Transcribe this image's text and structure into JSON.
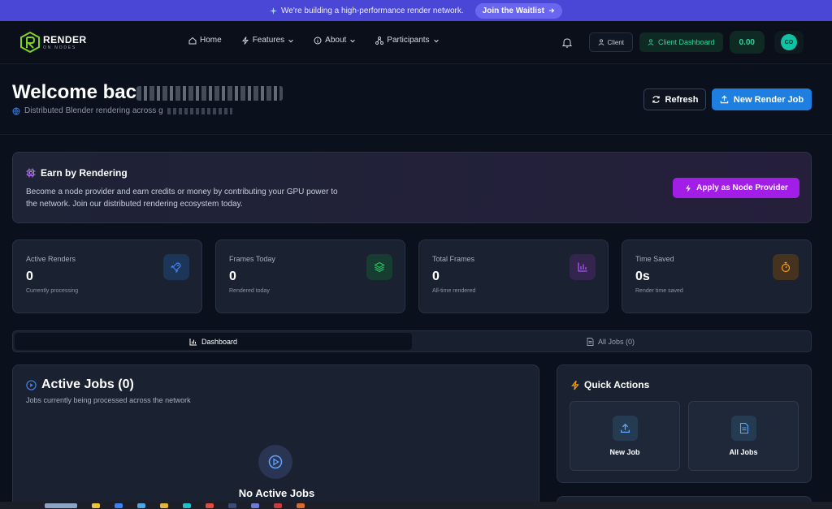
{
  "banner": {
    "message": "We're building a high-performance render network.",
    "cta": "Join the Waitlist"
  },
  "brand": {
    "name": "RENDER",
    "tagline": "ON NODES"
  },
  "nav": {
    "items": [
      {
        "label": "Home"
      },
      {
        "label": "Features"
      },
      {
        "label": "About"
      },
      {
        "label": "Participants"
      }
    ],
    "client_label": "Client",
    "dashboard_label": "Client Dashboard",
    "balance": "0.00",
    "avatar_initials": "CO"
  },
  "hero": {
    "welcome": "Welcome bac",
    "subtitle": "Distributed Blender rendering across g",
    "refresh_label": "Refresh",
    "new_job_label": "New Render Job"
  },
  "earn": {
    "title": "Earn by Rendering",
    "description": "Become a node provider and earn credits or money by contributing your GPU power to the network. Join our distributed rendering ecosystem today.",
    "cta": "Apply as Node Provider"
  },
  "stats": [
    {
      "label": "Active Renders",
      "value": "0",
      "note": "Currently processing",
      "icon": "rocket-icon",
      "color": "#3b82f6"
    },
    {
      "label": "Frames Today",
      "value": "0",
      "note": "Rendered today",
      "icon": "layers-icon",
      "color": "#22c55e"
    },
    {
      "label": "Total Frames",
      "value": "0",
      "note": "All-time rendered",
      "icon": "bar-chart-icon",
      "color": "#a855f7"
    },
    {
      "label": "Time Saved",
      "value": "0s",
      "note": "Render time saved",
      "icon": "stopwatch-icon",
      "color": "#f59e0b"
    }
  ],
  "tabs": [
    {
      "label": "Dashboard",
      "active": true
    },
    {
      "label": "All Jobs (0)",
      "active": false
    }
  ],
  "active_jobs": {
    "title": "Active Jobs (0)",
    "description": "Jobs currently being processed across the network",
    "empty_title": "No Active Jobs"
  },
  "quick_actions": {
    "title": "Quick Actions",
    "items": [
      {
        "label": "New Job",
        "icon": "upload-icon"
      },
      {
        "label": "All Jobs",
        "icon": "document-icon"
      }
    ]
  },
  "colors": {
    "banner": "#4a46d6",
    "accent_blue": "#1e7fe0",
    "accent_purple": "#a21ee6",
    "accent_green": "#2ed49b"
  }
}
